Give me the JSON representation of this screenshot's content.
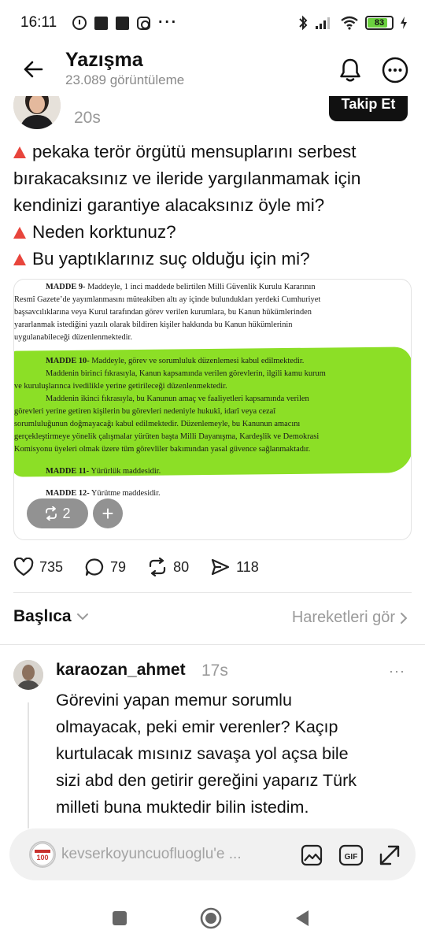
{
  "status_bar": {
    "time": "16:11",
    "more": "···",
    "battery_level": "83",
    "battery_color": "#6bd13f"
  },
  "header": {
    "title": "Yazışma",
    "subtitle": "23.089 görüntüleme",
    "back_icon": "arrow-left-icon",
    "bell_icon": "bell-icon",
    "more_icon": "more-circle-icon"
  },
  "post": {
    "time": "20s",
    "follow_label": "Takip Et",
    "lines": [
      "pekaka terör örgütü mensuplarını serbest",
      "bırakacaksınız ve ileride yargılanmamak için",
      "kendinizi garantiye alacaksınız öyle mi?",
      "Neden korktunuz?",
      "Bu yaptıklarınız suç olduğu için mi?"
    ],
    "bullet_color": "#e8453c",
    "image": {
      "highlight_color": "#86dd1a",
      "lines": [
        {
          "bold": "MADDE 9-",
          "text": " Maddeyle, 1 inci maddede belirtilen Milli Güvenlik Kurulu Kararının"
        },
        {
          "bold": "",
          "text": "Resmî Gazete’de yayımlanmasını müteakiben altı ay içinde bulundukları yerdeki Cumhuriyet"
        },
        {
          "bold": "",
          "text": "başsavcılıklarına veya Kurul tarafından görev verilen kurumlara, bu Kanun hükümlerinden"
        },
        {
          "bold": "",
          "text": "yararlanmak istediğini yazılı olarak bildiren kişiler hakkında bu Kanun hükümlerinin"
        },
        {
          "bold": "",
          "text": "uygulanabileceği düzenlenmektedir."
        },
        {
          "bold": "MADDE 10-",
          "text": " Maddeyle, görev ve sorumluluk düzenlemesi kabul edilmektedir."
        },
        {
          "bold": "",
          "text": "Maddenin birinci fıkrasıyla, Kanun kapsamında verilen görevlerin, ilgili kamu kurum"
        },
        {
          "bold": "",
          "text": "ve kuruluşlarınca ivedilikle yerine getirileceği düzenlenmektedir."
        },
        {
          "bold": "",
          "text": "Maddenin ikinci fıkrasıyla, bu Kanunun amaç ve faaliyetleri kapsamında verilen"
        },
        {
          "bold": "",
          "text": "görevleri yerine getiren kişilerin bu görevleri nedeniyle hukukî, idarî veya cezaî"
        },
        {
          "bold": "",
          "text": "sorumluluğunun doğmayacağı kabul edilmektedir. Düzenlemeyle, bu Kanunun amacını"
        },
        {
          "bold": "",
          "text": "gerçekleştirmeye yönelik çalışmalar yürüten başta Milli Dayanışma, Kardeşlik ve Demokrasi"
        },
        {
          "bold": "",
          "text": "Komisyonu üyeleri olmak üzere tüm görevliler bakımından yasal güvence sağlanmaktadır."
        },
        {
          "bold": "MADDE 11-",
          "text": " Yürürlük maddesidir."
        },
        {
          "bold": "MADDE 12-",
          "text": " Yürütme maddesidir."
        }
      ],
      "repost_count": "2",
      "plus_label": "+"
    },
    "actions": {
      "likes": "735",
      "comments": "79",
      "reposts": "80",
      "shares": "118"
    }
  },
  "sort": {
    "label": "Başlıca",
    "activity_link": "Hareketleri gör"
  },
  "reply": {
    "username": "karaozan_ahmet",
    "time": "17s",
    "more": "···",
    "lines": [
      "Görevini yapan memur sorumlu",
      "olmayacak, peki emir verenler? Kaçıp",
      "kurtulacak mısınız savaşa yol açsa bile",
      "sizi abd den getirir gereğini yaparız Türk",
      "milleti buna muktedir bilin istedim."
    ]
  },
  "composer": {
    "placeholder": "kevserkoyuncuofluoglu'e ...",
    "avatar_badge": "100",
    "gif_label": "GIF"
  }
}
